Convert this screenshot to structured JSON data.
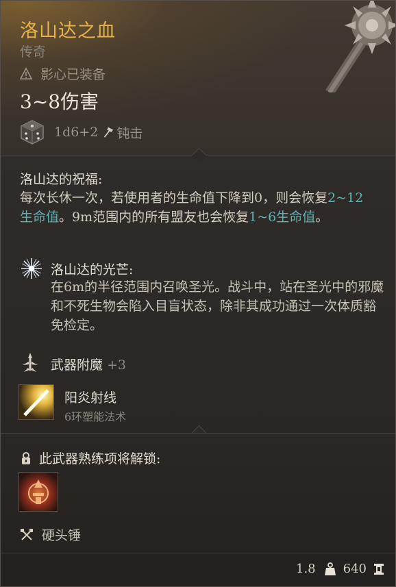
{
  "item": {
    "name": "洛山达之血",
    "rarity": "传奇",
    "equip_status": "影心已装备",
    "damage": "3~8伤害",
    "damage_dice": "1d6+2",
    "damage_type": "钝击"
  },
  "blessing": {
    "title": "洛山达的祝福:",
    "text_1": "每次长休一次，若使用者的生命值下降到0，则会恢复",
    "heal_1": "2~12生命值",
    "text_2": "。9m范围内的所有盟友也会恢复",
    "heal_2": "1~6生命值",
    "text_3": "。"
  },
  "radiance": {
    "title": "洛山达的光芒:",
    "text": "在6m的半径范围内召唤圣光。战斗中，站在圣光中的邪魔和不死生物会陷入目盲状态，除非其成功通过一次体质豁免检定。"
  },
  "enchantment": {
    "label": "武器附魔",
    "value": "+3"
  },
  "spell": {
    "name": "阳炎射线",
    "subtitle": "6环塑能法术"
  },
  "proficiency": {
    "title": "此武器熟练项将解锁:",
    "weapon_type": "硬头锤"
  },
  "footer": {
    "weight": "1.8",
    "value": "640"
  },
  "colors": {
    "title": "#e6b34a",
    "highlight": "#5fb3b3"
  },
  "icons": [
    "warning-icon",
    "dice-icon",
    "bludgeon-icon",
    "radiance-icon",
    "enchant-icon",
    "spell-icon",
    "lock-icon",
    "proficiency-icon",
    "mace-icon",
    "weight-icon",
    "gold-icon"
  ]
}
